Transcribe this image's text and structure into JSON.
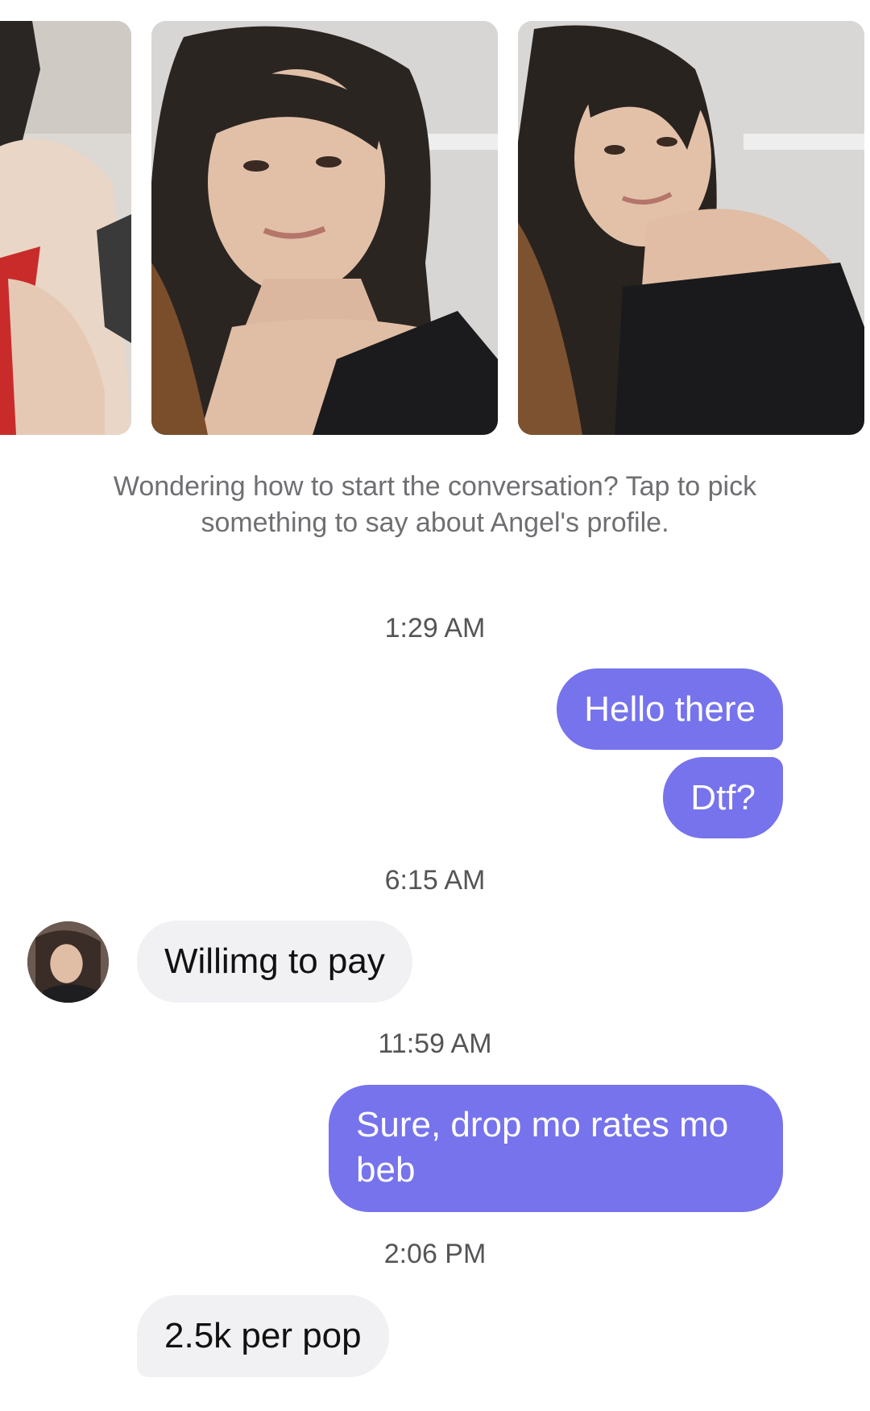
{
  "profile": {
    "name": "Angel"
  },
  "gallery": {
    "photos": [
      {
        "icon": "profile-photo-icon"
      },
      {
        "icon": "profile-photo-icon"
      },
      {
        "icon": "profile-photo-icon"
      }
    ]
  },
  "prompt": {
    "text": "Wondering how to start the conversation? Tap to pick something to say about Angel's profile."
  },
  "colors": {
    "outgoing_bubble": "#7673ec",
    "incoming_bubble": "#f1f1f4"
  },
  "conversation": {
    "timestamps": [
      "1:29 AM",
      "6:15 AM",
      "11:59 AM",
      "2:06 PM"
    ],
    "messages": [
      {
        "direction": "outgoing",
        "text": "Hello there"
      },
      {
        "direction": "outgoing",
        "text": "Dtf?"
      },
      {
        "direction": "incoming",
        "text": "Willimg to pay"
      },
      {
        "direction": "outgoing",
        "text": "Sure, drop mo rates mo beb"
      },
      {
        "direction": "incoming",
        "text": "2.5k per pop"
      }
    ]
  }
}
